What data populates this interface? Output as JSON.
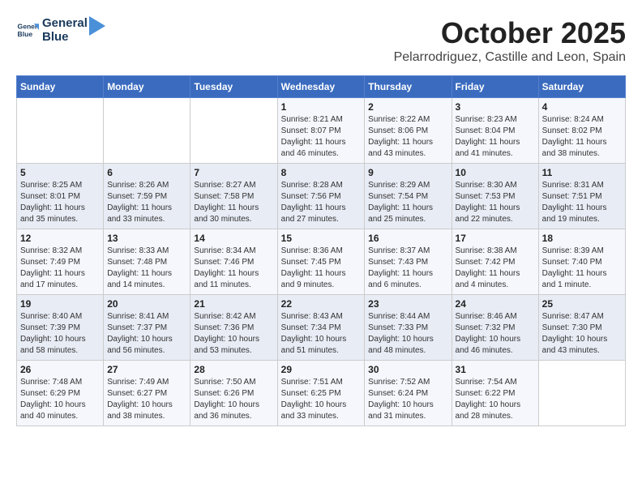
{
  "logo": {
    "line1": "General",
    "line2": "Blue"
  },
  "header": {
    "month": "October 2025",
    "location": "Pelarrodriguez, Castille and Leon, Spain"
  },
  "days_of_week": [
    "Sunday",
    "Monday",
    "Tuesday",
    "Wednesday",
    "Thursday",
    "Friday",
    "Saturday"
  ],
  "weeks": [
    [
      {
        "day": "",
        "info": ""
      },
      {
        "day": "",
        "info": ""
      },
      {
        "day": "",
        "info": ""
      },
      {
        "day": "1",
        "info": "Sunrise: 8:21 AM\nSunset: 8:07 PM\nDaylight: 11 hours and 46 minutes."
      },
      {
        "day": "2",
        "info": "Sunrise: 8:22 AM\nSunset: 8:06 PM\nDaylight: 11 hours and 43 minutes."
      },
      {
        "day": "3",
        "info": "Sunrise: 8:23 AM\nSunset: 8:04 PM\nDaylight: 11 hours and 41 minutes."
      },
      {
        "day": "4",
        "info": "Sunrise: 8:24 AM\nSunset: 8:02 PM\nDaylight: 11 hours and 38 minutes."
      }
    ],
    [
      {
        "day": "5",
        "info": "Sunrise: 8:25 AM\nSunset: 8:01 PM\nDaylight: 11 hours and 35 minutes."
      },
      {
        "day": "6",
        "info": "Sunrise: 8:26 AM\nSunset: 7:59 PM\nDaylight: 11 hours and 33 minutes."
      },
      {
        "day": "7",
        "info": "Sunrise: 8:27 AM\nSunset: 7:58 PM\nDaylight: 11 hours and 30 minutes."
      },
      {
        "day": "8",
        "info": "Sunrise: 8:28 AM\nSunset: 7:56 PM\nDaylight: 11 hours and 27 minutes."
      },
      {
        "day": "9",
        "info": "Sunrise: 8:29 AM\nSunset: 7:54 PM\nDaylight: 11 hours and 25 minutes."
      },
      {
        "day": "10",
        "info": "Sunrise: 8:30 AM\nSunset: 7:53 PM\nDaylight: 11 hours and 22 minutes."
      },
      {
        "day": "11",
        "info": "Sunrise: 8:31 AM\nSunset: 7:51 PM\nDaylight: 11 hours and 19 minutes."
      }
    ],
    [
      {
        "day": "12",
        "info": "Sunrise: 8:32 AM\nSunset: 7:49 PM\nDaylight: 11 hours and 17 minutes."
      },
      {
        "day": "13",
        "info": "Sunrise: 8:33 AM\nSunset: 7:48 PM\nDaylight: 11 hours and 14 minutes."
      },
      {
        "day": "14",
        "info": "Sunrise: 8:34 AM\nSunset: 7:46 PM\nDaylight: 11 hours and 11 minutes."
      },
      {
        "day": "15",
        "info": "Sunrise: 8:36 AM\nSunset: 7:45 PM\nDaylight: 11 hours and 9 minutes."
      },
      {
        "day": "16",
        "info": "Sunrise: 8:37 AM\nSunset: 7:43 PM\nDaylight: 11 hours and 6 minutes."
      },
      {
        "day": "17",
        "info": "Sunrise: 8:38 AM\nSunset: 7:42 PM\nDaylight: 11 hours and 4 minutes."
      },
      {
        "day": "18",
        "info": "Sunrise: 8:39 AM\nSunset: 7:40 PM\nDaylight: 11 hours and 1 minute."
      }
    ],
    [
      {
        "day": "19",
        "info": "Sunrise: 8:40 AM\nSunset: 7:39 PM\nDaylight: 10 hours and 58 minutes."
      },
      {
        "day": "20",
        "info": "Sunrise: 8:41 AM\nSunset: 7:37 PM\nDaylight: 10 hours and 56 minutes."
      },
      {
        "day": "21",
        "info": "Sunrise: 8:42 AM\nSunset: 7:36 PM\nDaylight: 10 hours and 53 minutes."
      },
      {
        "day": "22",
        "info": "Sunrise: 8:43 AM\nSunset: 7:34 PM\nDaylight: 10 hours and 51 minutes."
      },
      {
        "day": "23",
        "info": "Sunrise: 8:44 AM\nSunset: 7:33 PM\nDaylight: 10 hours and 48 minutes."
      },
      {
        "day": "24",
        "info": "Sunrise: 8:46 AM\nSunset: 7:32 PM\nDaylight: 10 hours and 46 minutes."
      },
      {
        "day": "25",
        "info": "Sunrise: 8:47 AM\nSunset: 7:30 PM\nDaylight: 10 hours and 43 minutes."
      }
    ],
    [
      {
        "day": "26",
        "info": "Sunrise: 7:48 AM\nSunset: 6:29 PM\nDaylight: 10 hours and 40 minutes."
      },
      {
        "day": "27",
        "info": "Sunrise: 7:49 AM\nSunset: 6:27 PM\nDaylight: 10 hours and 38 minutes."
      },
      {
        "day": "28",
        "info": "Sunrise: 7:50 AM\nSunset: 6:26 PM\nDaylight: 10 hours and 36 minutes."
      },
      {
        "day": "29",
        "info": "Sunrise: 7:51 AM\nSunset: 6:25 PM\nDaylight: 10 hours and 33 minutes."
      },
      {
        "day": "30",
        "info": "Sunrise: 7:52 AM\nSunset: 6:24 PM\nDaylight: 10 hours and 31 minutes."
      },
      {
        "day": "31",
        "info": "Sunrise: 7:54 AM\nSunset: 6:22 PM\nDaylight: 10 hours and 28 minutes."
      },
      {
        "day": "",
        "info": ""
      }
    ]
  ]
}
